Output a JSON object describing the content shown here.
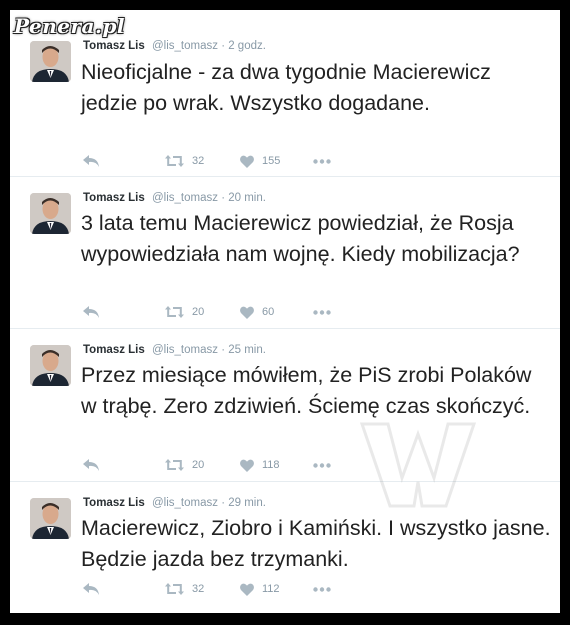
{
  "watermark": "Penera.pl",
  "tweets": [
    {
      "name": "Tomasz Lis",
      "handle": "@lis_tomasz",
      "time": "· 2 godz.",
      "text": "Nieoficjalne - za dwa tygodnie Macierewicz jedzie po wrak. Wszystko dogadane.",
      "retweets": "32",
      "likes": "155"
    },
    {
      "name": "Tomasz Lis",
      "handle": "@lis_tomasz",
      "time": "· 20 min.",
      "text": "3 lata temu Macierewicz powiedział, że Rosja wypowiedziała nam wojnę. Kiedy mobilizacja?",
      "retweets": "20",
      "likes": "60"
    },
    {
      "name": "Tomasz Lis",
      "handle": "@lis_tomasz",
      "time": "· 25 min.",
      "text": "Przez miesiące mówiłem, że PiS zrobi Polaków w trąbę. Zero zdziwień. Ściemę czas skończyć.",
      "retweets": "20",
      "likes": "118"
    },
    {
      "name": "Tomasz Lis",
      "handle": "@lis_tomasz",
      "time": "· 29 min.",
      "text": "Macierewicz, Ziobro i Kamiński. I wszystko jasne. Będzie jazda bez trzymanki.",
      "retweets": "32",
      "likes": "112"
    }
  ],
  "icons": {
    "reply": "reply-icon",
    "retweet": "retweet-icon",
    "like": "heart-icon",
    "more": "more-dots-icon"
  },
  "colors": {
    "icon": "#aab8c2",
    "text": "#222222",
    "meta": "#8899a6"
  }
}
